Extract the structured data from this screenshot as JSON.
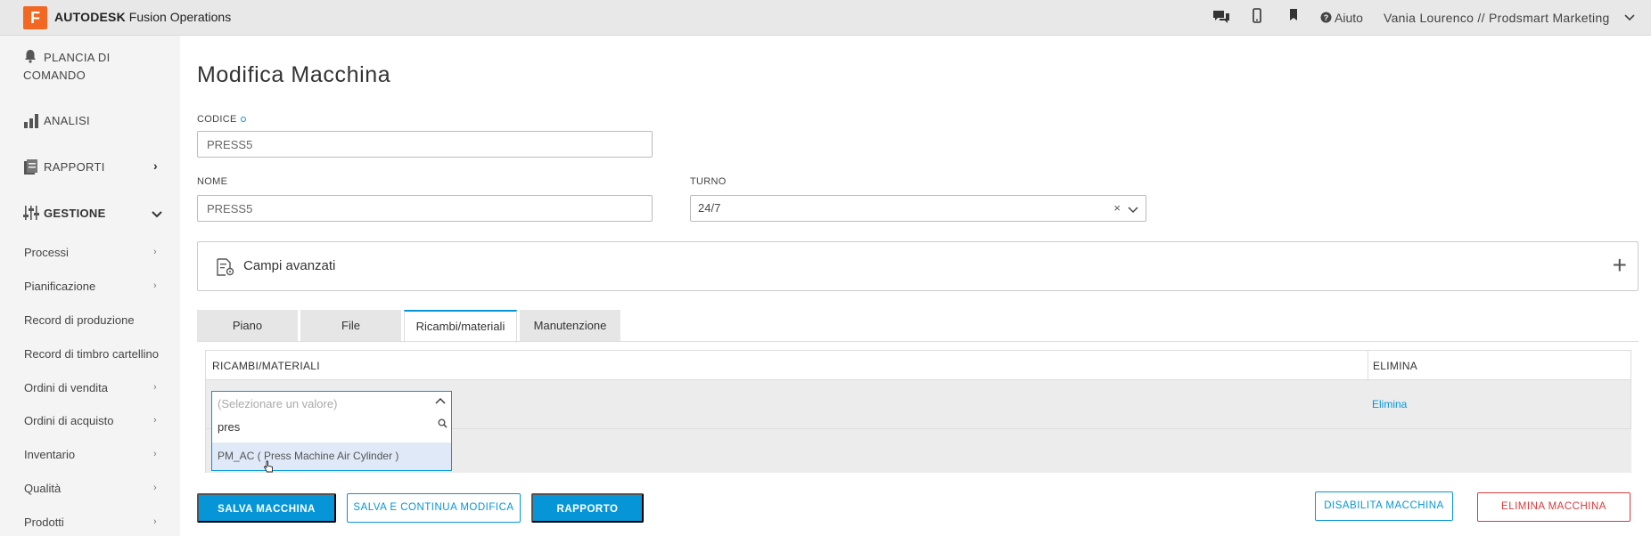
{
  "header": {
    "logo_letter": "F",
    "brand_bold": "AUTODESK",
    "brand_rest": " Fusion Operations",
    "help_label": "Aiuto",
    "user_label": "Vania Lourenco // Prodsmart Marketing"
  },
  "sidebar": {
    "dashboard_line1": "PLANCIA DI",
    "dashboard_line2": "COMANDO",
    "analytics": "ANALISI",
    "reports": "RAPPORTI",
    "management": "GESTIONE",
    "sub_items": [
      "Processi",
      "Pianificazione",
      "Record di produzione",
      "Record di timbro cartellino",
      "Ordini di vendita",
      "Ordini di acquisto",
      "Inventario",
      "Qualità",
      "Prodotti"
    ]
  },
  "main": {
    "title": "Modifica Macchina",
    "code_label": "CODICE",
    "code_value": "PRESS5",
    "name_label": "NOME",
    "name_value": "PRESS5",
    "shift_label": "TURNO",
    "shift_value": "24/7",
    "advanced_label": "Campi avanzati",
    "tabs": [
      "Piano",
      "File",
      "Ricambi/materiali",
      "Manutenzione"
    ],
    "table_headers": [
      "RICAMBI/MATERIALI",
      "ELIMINA"
    ],
    "row_delete": "Elimina",
    "dropdown_placeholder": "(Selezionare un valore)",
    "dropdown_search": "pres",
    "dropdown_option": "PM_AC ( Press Machine Air Cylinder )"
  },
  "buttons": {
    "save": "SALVA MACCHINA",
    "save_continue": "SALVA E CONTINUA MODIFICA",
    "report": "RAPPORTO",
    "disable": "DISABILITA MACCHINA",
    "delete": "ELIMINA MACCHINA"
  },
  "colors": {
    "accent": "#0696d7",
    "danger": "#d73c3c",
    "logo": "#f26722"
  }
}
